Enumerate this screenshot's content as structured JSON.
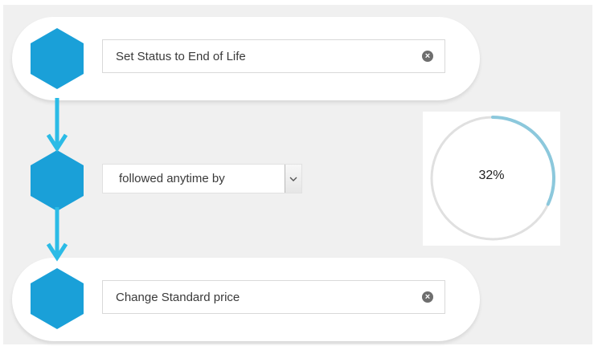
{
  "workflow": {
    "steps": [
      {
        "label": "Set Status to End of Life",
        "clear_icon": "close-circle-icon"
      },
      {
        "label": "Change Standard price",
        "clear_icon": "close-circle-icon"
      }
    ],
    "connector": {
      "selected": "followed anytime by",
      "caret_icon": "chevron-down-icon"
    },
    "node_icon": "hexagon-icon",
    "arrow_icon": "arrow-down-icon"
  },
  "progress": {
    "text": "32%",
    "fraction": 0.32
  },
  "colors": {
    "accent": "#1aa0d8",
    "arrow": "#2bbbe6",
    "progress_arc": "#8cc8dc",
    "progress_track": "#e0e0e0",
    "background": "#f0f0f0"
  }
}
